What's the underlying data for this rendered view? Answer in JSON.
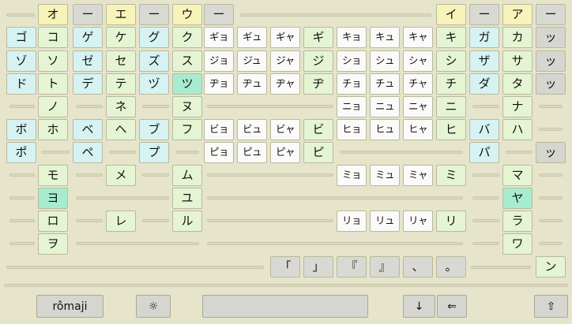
{
  "vowels": [
    "オ",
    "ー",
    "エ",
    "ー",
    "ウ",
    "ー",
    "イ",
    "ー",
    "ア",
    "ー"
  ],
  "rows": [
    {
      "left": [
        "ゴ",
        "コ",
        "ゲ",
        "ケ",
        "グ",
        "ク"
      ],
      "mid": [
        "ギョ",
        "ギュ",
        "ギャ",
        "ギ",
        "キョ",
        "キュ",
        "キャ",
        "キ"
      ],
      "right": [
        "ガ",
        "カ",
        "ッ"
      ]
    },
    {
      "left": [
        "ゾ",
        "ソ",
        "ゼ",
        "セ",
        "ズ",
        "ス"
      ],
      "mid": [
        "ジョ",
        "ジュ",
        "ジャ",
        "ジ",
        "ショ",
        "シュ",
        "シャ",
        "シ"
      ],
      "right": [
        "ザ",
        "サ",
        "ッ"
      ]
    },
    {
      "left": [
        "ド",
        "ト",
        "デ",
        "テ",
        "ヅ",
        "ツ"
      ],
      "mid": [
        "ヂョ",
        "ヂュ",
        "ヂャ",
        "ヂ",
        "チョ",
        "チュ",
        "チャ",
        "チ"
      ],
      "right": [
        "ダ",
        "タ",
        "ッ"
      ]
    },
    {
      "left": [
        "",
        "ノ",
        "",
        "ネ",
        "",
        "ヌ"
      ],
      "mid": [
        "",
        "",
        "",
        "",
        "ニョ",
        "ニュ",
        "ニャ",
        "ニ"
      ],
      "right": [
        "",
        "ナ",
        ""
      ]
    },
    {
      "left": [
        "ボ",
        "ホ",
        "ベ",
        "ヘ",
        "ブ",
        "フ"
      ],
      "mid": [
        "ビョ",
        "ビュ",
        "ビャ",
        "ビ",
        "ヒョ",
        "ヒュ",
        "ヒャ",
        "ヒ"
      ],
      "right": [
        "バ",
        "ハ",
        ""
      ]
    },
    {
      "left": [
        "ポ",
        "",
        "ペ",
        "",
        "プ",
        ""
      ],
      "mid": [
        "ピョ",
        "ピュ",
        "ピャ",
        "ピ",
        "",
        "",
        "",
        ""
      ],
      "right": [
        "パ",
        "",
        "ッ"
      ]
    },
    {
      "left": [
        "",
        "モ",
        "",
        "メ",
        "",
        "ム"
      ],
      "mid": [
        "",
        "",
        "",
        "",
        "ミョ",
        "ミュ",
        "ミャ",
        "ミ"
      ],
      "right": [
        "",
        "マ",
        ""
      ]
    },
    {
      "left": [
        "",
        "ヨ",
        "",
        "",
        "",
        "ユ"
      ],
      "mid": [
        "",
        "",
        "",
        "",
        "",
        "",
        "",
        ""
      ],
      "right": [
        "",
        "ヤ",
        ""
      ]
    },
    {
      "left": [
        "",
        "ロ",
        "",
        "レ",
        "",
        "ル"
      ],
      "mid": [
        "",
        "",
        "",
        "",
        "リョ",
        "リュ",
        "リャ",
        "リ"
      ],
      "right": [
        "",
        "ラ",
        ""
      ]
    },
    {
      "left": [
        "",
        "ヲ",
        "",
        "",
        "",
        ""
      ],
      "mid": [
        "",
        "",
        "",
        "",
        "",
        "",
        "",
        ""
      ],
      "right": [
        "",
        "ワ",
        ""
      ]
    }
  ],
  "punctuation": [
    "「",
    "」",
    "『",
    "』",
    "、",
    "。"
  ],
  "n_key": "ン",
  "bottom": {
    "romaji": "rômaji",
    "brightness": "☼",
    "down": "↓",
    "backspace": "⇐",
    "shift": "⇧"
  },
  "colors": {
    "background": "#e6e5cc",
    "vowel": "#f8f3b8",
    "dash": "#d9d9d4",
    "voiced": "#d6f2f2",
    "base": "#e5f5d3",
    "compound": "#fafaf8",
    "highlight": "#a8ecd0",
    "tsu": "#d6d6d0"
  }
}
